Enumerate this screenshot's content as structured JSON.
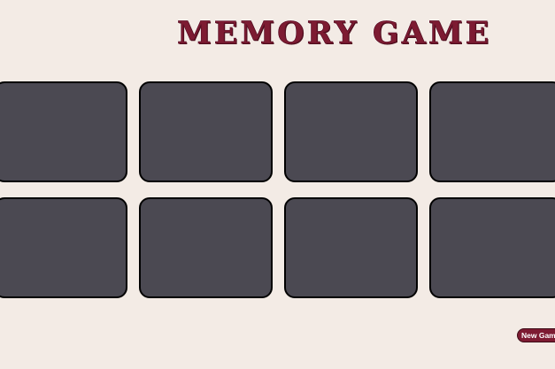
{
  "title": "MEMORY GAME",
  "new_game_label": "New Game",
  "colors": {
    "background": "#f3ebe5",
    "card_back": "#4b4952",
    "accent": "#7d1b32"
  },
  "cards": [
    {
      "state": "face-down"
    },
    {
      "state": "face-down"
    },
    {
      "state": "face-down"
    },
    {
      "state": "face-down"
    },
    {
      "state": "face-down"
    },
    {
      "state": "face-down"
    },
    {
      "state": "face-down"
    },
    {
      "state": "face-down"
    }
  ]
}
